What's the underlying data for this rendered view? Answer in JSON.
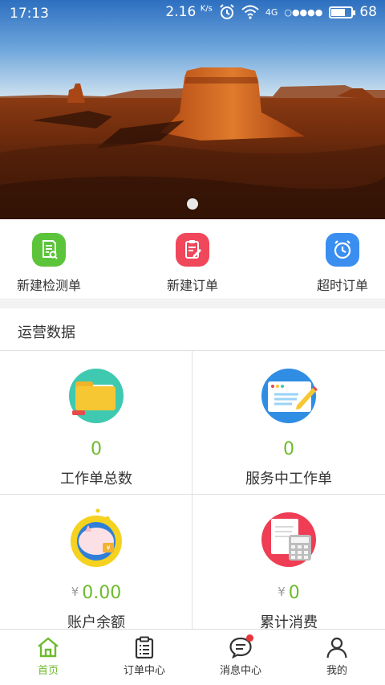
{
  "status_bar": {
    "time": "17:13",
    "speed": "2.16",
    "speed_unit": "K/s",
    "network": "4G",
    "signal": "○●●●●",
    "battery": "68"
  },
  "banner": {
    "slides": 1,
    "active_slide": 1
  },
  "quick_actions": [
    {
      "label": "新建检测单",
      "icon": "inspection-doc-icon",
      "color": "#5cc43a"
    },
    {
      "label": "新建订单",
      "icon": "new-order-icon",
      "color": "#f0475b"
    },
    {
      "label": "超时订单",
      "icon": "alarm-clock-icon",
      "color": "#3a8ef0"
    }
  ],
  "operations": {
    "title": "运营数据",
    "cards": [
      {
        "value": "0",
        "currency": "",
        "label": "工作单总数",
        "icon": "folder-icon"
      },
      {
        "value": "0",
        "currency": "",
        "label": "服务中工作单",
        "icon": "document-pencil-icon"
      },
      {
        "value": "0.00",
        "currency": "¥",
        "label": "账户余额",
        "icon": "piggy-bank-icon"
      },
      {
        "value": "0",
        "currency": "¥",
        "label": "累计消费",
        "icon": "calculator-icon"
      }
    ]
  },
  "tabbar": {
    "items": [
      {
        "label": "首页",
        "icon": "home-icon",
        "active": true
      },
      {
        "label": "订单中心",
        "icon": "clipboard-icon",
        "active": false
      },
      {
        "label": "消息中心",
        "icon": "chat-bubble-icon",
        "active": false,
        "badge": true
      },
      {
        "label": "我的",
        "icon": "person-icon",
        "active": false
      }
    ],
    "active_color": "#6dbb2c"
  }
}
